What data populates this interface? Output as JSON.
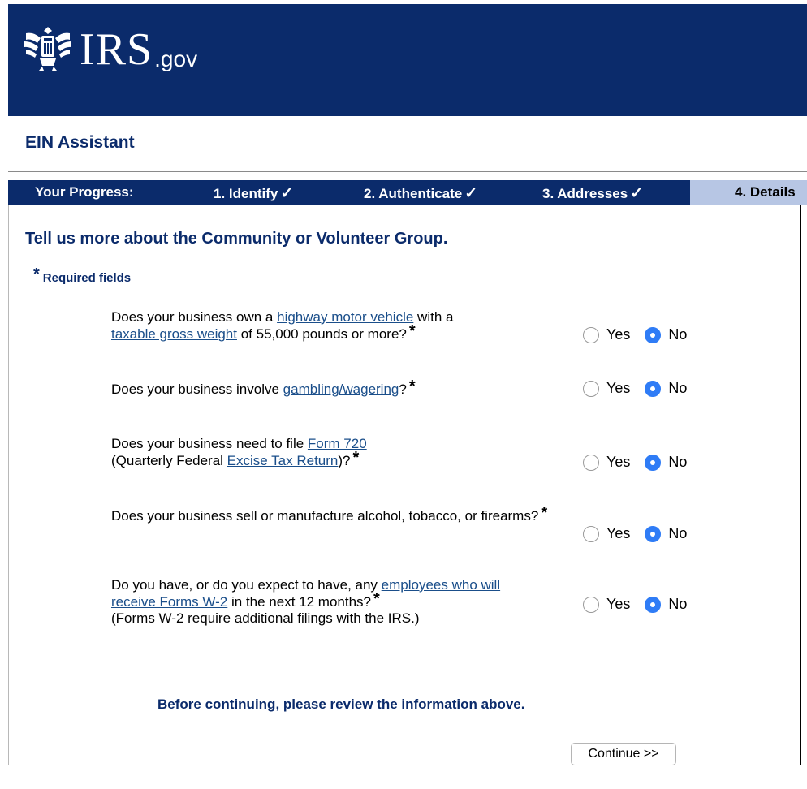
{
  "site": {
    "logo_text": "IRS",
    "logo_suffix": ".gov"
  },
  "app": {
    "title": "EIN Assistant"
  },
  "progress": {
    "label": "Your Progress:",
    "steps": [
      {
        "label": "1. Identify",
        "done": true
      },
      {
        "label": "2. Authenticate",
        "done": true
      },
      {
        "label": "3. Addresses",
        "done": true
      },
      {
        "label": "4. Details",
        "current": true
      }
    ],
    "check_glyph": "✓"
  },
  "page": {
    "heading": "Tell us more about the Community or Volunteer Group.",
    "required_note": "Required fields",
    "required_star": "*"
  },
  "questions": [
    {
      "parts": [
        "Does your business own a ",
        "highway motor vehicle",
        " with a ",
        "taxable gross weight",
        " of 55,000 pounds or more?"
      ],
      "answer": "No"
    },
    {
      "parts": [
        "Does your business involve ",
        "gambling/wagering",
        "?"
      ],
      "answer": "No"
    },
    {
      "parts": [
        "Does your business need to file ",
        "Form 720",
        "(Quarterly Federal ",
        "Excise Tax Return",
        ")?"
      ],
      "answer": "No"
    },
    {
      "parts": [
        "Does your business sell or manufacture alcohol, tobacco, or firearms?"
      ],
      "answer": "No"
    },
    {
      "parts": [
        "Do you have, or do you expect to have, any ",
        "employees who will receive Forms W-2",
        " in the next 12 months?",
        "(Forms W-2 require additional filings with the IRS.)"
      ],
      "answer": "No"
    }
  ],
  "options": {
    "yes": "Yes",
    "no": "No"
  },
  "footer": {
    "review_note": "Before continuing, please review the information above.",
    "continue_label": "Continue >>"
  },
  "colors": {
    "brand_navy": "#0b2b6b",
    "current_step": "#b7c6e4",
    "radio_selected": "#2f7cf6",
    "link": "#1a4e8a"
  },
  "icons": [
    "irs-eagle-logo-icon",
    "check-icon",
    "radio-icon"
  ]
}
